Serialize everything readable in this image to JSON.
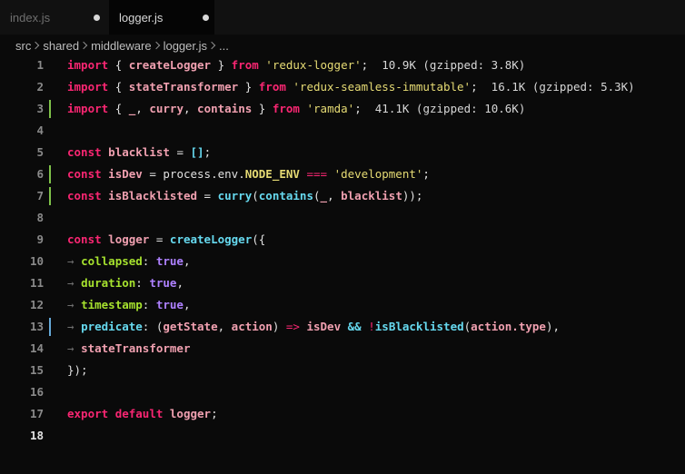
{
  "tabs": [
    {
      "label": "index.js",
      "modified": true
    },
    {
      "label": "logger.js",
      "modified": true
    }
  ],
  "breadcrumb": [
    "src",
    "shared",
    "middleware",
    "logger.js",
    "..."
  ],
  "editor": {
    "current_line": "18",
    "line_numbers": [
      "1",
      "2",
      "3",
      "4",
      "5",
      "6",
      "7",
      "8",
      "9",
      "10",
      "11",
      "12",
      "13",
      "14",
      "15",
      "16",
      "17",
      "18"
    ],
    "gutter_colors": {
      "line_changed": "#7fc34a",
      "line_modified": "#66a9d8"
    },
    "lines": [
      {
        "n": "1",
        "parts": [
          "import",
          "{",
          "createLogger",
          "}",
          "from",
          "'redux-logger'",
          ";",
          "10.9K (gzipped: 3.8K)"
        ]
      },
      {
        "n": "2",
        "parts": [
          "import",
          "{",
          "stateTransformer",
          "}",
          "from",
          "'redux-seamless-immutable'",
          ";",
          "16.1K (gzipped: 5.3K)"
        ]
      },
      {
        "n": "3",
        "parts": [
          "import",
          "{",
          "_",
          ",",
          "curry",
          ",",
          "contains",
          "}",
          "from",
          "'ramda'",
          ";",
          "41.1K (gzipped: 10.6K)"
        ]
      },
      {
        "n": "4",
        "parts": []
      },
      {
        "n": "5",
        "parts": [
          "const",
          "blacklist",
          "=",
          "[]",
          ";"
        ]
      },
      {
        "n": "6",
        "parts": [
          "const",
          "isDev",
          "=",
          "process.env.",
          "NODE_ENV",
          "===",
          "'development'",
          ";"
        ]
      },
      {
        "n": "7",
        "parts": [
          "const",
          "isBlacklisted",
          "=",
          "curry",
          "(",
          "contains",
          "(",
          "_",
          ",",
          "blacklist",
          "))",
          ";"
        ]
      },
      {
        "n": "8",
        "parts": []
      },
      {
        "n": "9",
        "parts": [
          "const",
          "logger",
          "=",
          "createLogger",
          "({"
        ]
      },
      {
        "n": "10",
        "parts": [
          "→",
          "collapsed",
          ":",
          "true",
          ","
        ]
      },
      {
        "n": "11",
        "parts": [
          "→",
          "duration",
          ":",
          "true",
          ","
        ]
      },
      {
        "n": "12",
        "parts": [
          "→",
          "timestamp",
          ":",
          "true",
          ","
        ]
      },
      {
        "n": "13",
        "parts": [
          "→",
          "predicate",
          ":",
          "(",
          "getState",
          ",",
          "action",
          ")",
          "=>",
          "isDev",
          "&&",
          "!",
          "isBlacklisted",
          "(",
          "action.type",
          ")",
          ","
        ]
      },
      {
        "n": "14",
        "parts": [
          "→",
          "stateTransformer"
        ]
      },
      {
        "n": "15",
        "parts": [
          "});"
        ]
      },
      {
        "n": "16",
        "parts": []
      },
      {
        "n": "17",
        "parts": [
          "export",
          "default",
          "logger",
          ";"
        ]
      },
      {
        "n": "18",
        "parts": []
      }
    ]
  },
  "icons": {
    "tab_modified": "filled-dot",
    "breadcrumb_separator": "chevron-right"
  },
  "colors": {
    "keyword": "#f92672",
    "string": "#e6db74",
    "function": "#66d9ef",
    "property": "#a6e22e",
    "constant": "#ae81ff"
  }
}
